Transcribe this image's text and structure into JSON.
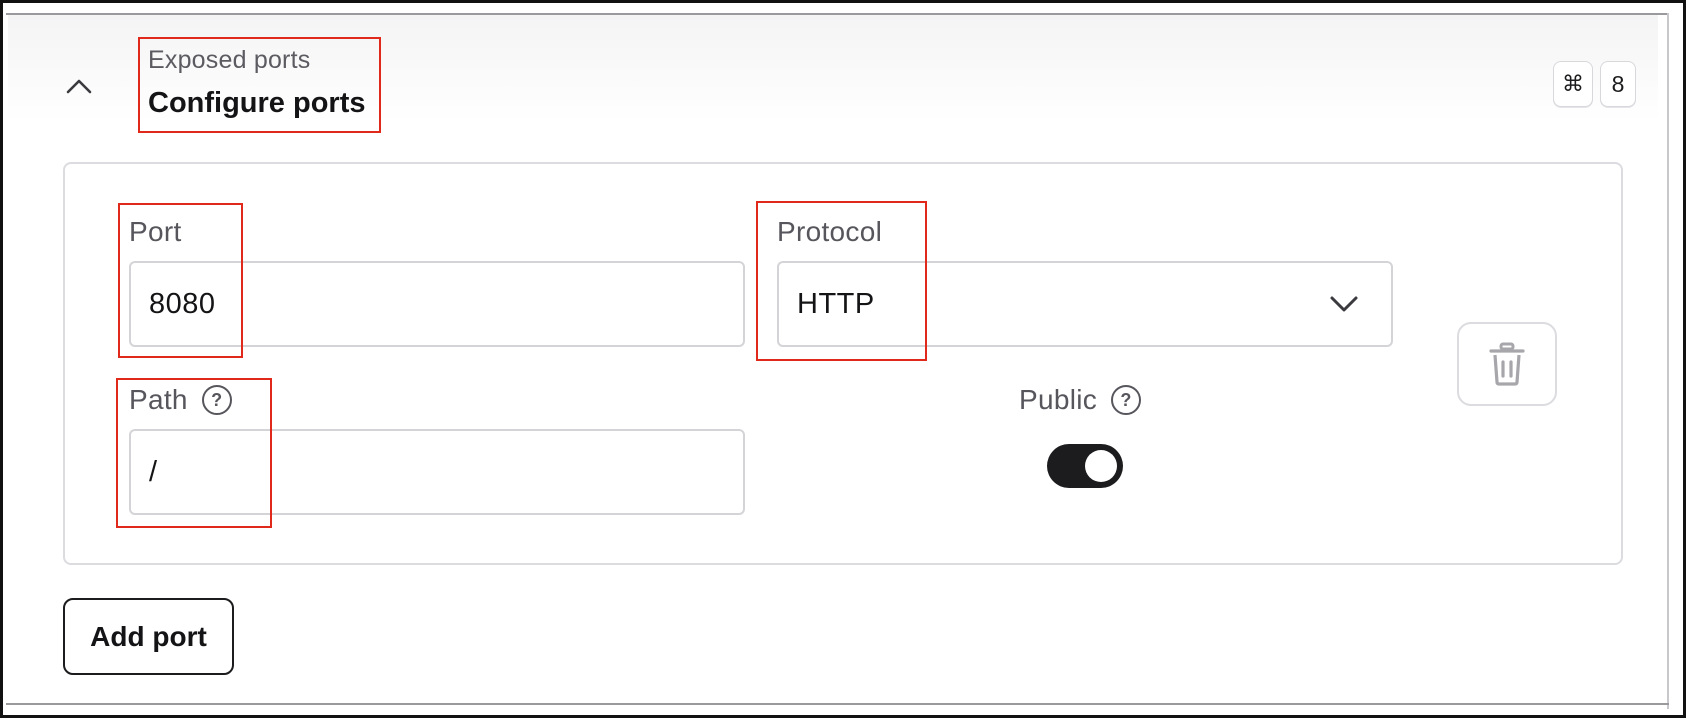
{
  "section": {
    "subtitle": "Exposed ports",
    "title": "Configure ports",
    "collapse_icon": "chevron-up-icon",
    "shortcut": {
      "modifier": "⌘",
      "key": "8"
    }
  },
  "port_entry": {
    "port": {
      "label": "Port",
      "value": "8080"
    },
    "protocol": {
      "label": "Protocol",
      "value": "HTTP",
      "icon": "chevron-down-icon"
    },
    "path": {
      "label": "Path",
      "value": "/",
      "help_icon": "question-circle-icon",
      "help_glyph": "?"
    },
    "public": {
      "label": "Public",
      "enabled": true,
      "help_icon": "question-circle-icon",
      "help_glyph": "?"
    },
    "delete_icon": "trash-icon"
  },
  "actions": {
    "add_port_label": "Add port"
  },
  "colors": {
    "highlight": "#e0281b",
    "toggle_on": "#1c1c1e",
    "muted_text": "#56565c"
  }
}
